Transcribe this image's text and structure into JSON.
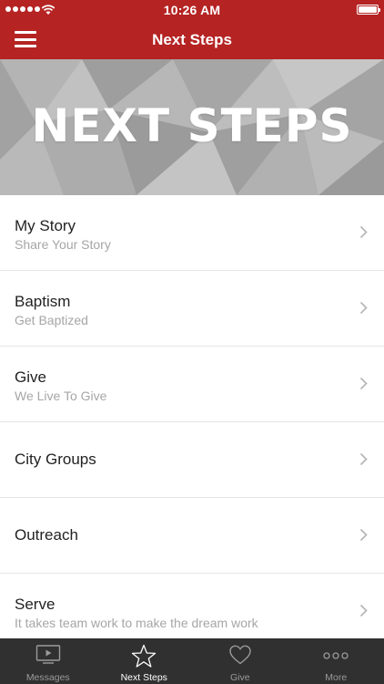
{
  "status_bar": {
    "time": "10:26 AM",
    "signal_icon": "signal-dots-icon",
    "wifi_icon": "wifi-icon",
    "battery_icon": "battery-icon"
  },
  "nav": {
    "title": "Next Steps",
    "menu_icon": "hamburger-menu-icon"
  },
  "banner": {
    "title": "NEXT STEPS"
  },
  "list": [
    {
      "title": "My Story",
      "subtitle": "Share Your Story"
    },
    {
      "title": "Baptism",
      "subtitle": "Get Baptized"
    },
    {
      "title": "Give",
      "subtitle": "We Live To Give"
    },
    {
      "title": "City Groups",
      "subtitle": ""
    },
    {
      "title": "Outreach",
      "subtitle": ""
    },
    {
      "title": "Serve",
      "subtitle": "It takes team work to make the dream work"
    }
  ],
  "tabs": [
    {
      "label": "Messages",
      "icon": "tv-play-icon",
      "active": false
    },
    {
      "label": "Next Steps",
      "icon": "star-icon",
      "active": true
    },
    {
      "label": "Give",
      "icon": "heart-icon",
      "active": false
    },
    {
      "label": "More",
      "icon": "more-dots-icon",
      "active": false
    }
  ],
  "colors": {
    "brand_red": "#b52323",
    "tab_bar_bg": "#303030",
    "subtitle_gray": "#a6a6a6"
  }
}
